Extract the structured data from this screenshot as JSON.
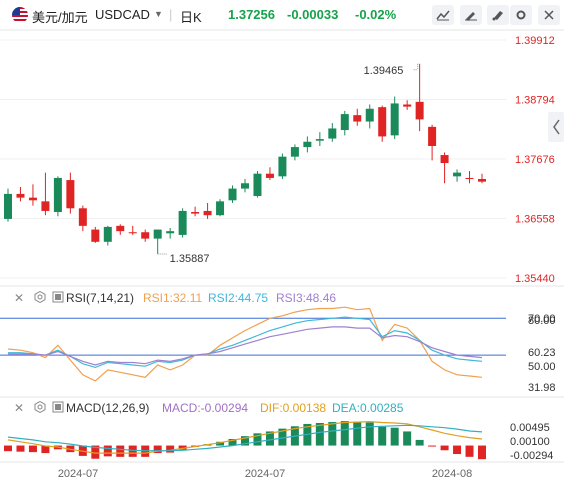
{
  "header": {
    "symbol": "美元/加元",
    "code": "USDCAD",
    "dropdown_icon": "caret-down-icon",
    "timeframe": "日K",
    "price": "1.37256",
    "change": "-0.00033",
    "change_pct": "-0.02%",
    "colors": {
      "up": "#16a34a",
      "down": "#e02424",
      "neutral": "#222222"
    }
  },
  "toolbar_icons": [
    "line-chart-icon",
    "draw-icon",
    "brush-icon",
    "settings-icon",
    "expand-icon",
    "close-icon"
  ],
  "collapse_icon": "chevron-left-icon",
  "rsi_panel": {
    "label": "RSI(7,14,21)",
    "rsi1": "RSI1:32.11",
    "rsi2": "RSI2:44.75",
    "rsi3": "RSI3:48.46",
    "colors": {
      "rsi1": "#f0a050",
      "rsi2": "#40b8d8",
      "rsi3": "#a080d0"
    },
    "axis_labels": [
      "80.00",
      "70.00",
      "60.23",
      "50.00",
      "31.98"
    ]
  },
  "macd_panel": {
    "label": "MACD(12,26,9)",
    "macd": "MACD:-0.00294",
    "dif": "DIF:0.00138",
    "dea": "DEA:0.00285",
    "colors": {
      "macd": "#a070c8",
      "dif": "#e0a020",
      "dea": "#30b0c0"
    },
    "axis_labels": [
      "0.00495",
      "0.00100",
      "-0.00294"
    ]
  },
  "panel_icons": [
    "close-icon",
    "settings-icon",
    "indicator-icon"
  ],
  "chart_data": {
    "type": "candlestick",
    "y_axis_labels": [
      "1.39912",
      "1.38794",
      "1.37676",
      "1.36558",
      "1.35440"
    ],
    "ylim": [
      1.3544,
      1.39912
    ],
    "x_labels": [
      "2024-07",
      "2024-07",
      "2024-08"
    ],
    "annotations": {
      "high": "1.39465",
      "low": "1.35887"
    },
    "colors": {
      "up": "#1a8a5a",
      "down": "#e02424"
    },
    "candles": [
      {
        "o": 1.3655,
        "h": 1.3712,
        "l": 1.365,
        "c": 1.3702
      },
      {
        "o": 1.3702,
        "h": 1.3715,
        "l": 1.3688,
        "c": 1.3695
      },
      {
        "o": 1.3695,
        "h": 1.372,
        "l": 1.368,
        "c": 1.369
      },
      {
        "o": 1.3688,
        "h": 1.3742,
        "l": 1.3662,
        "c": 1.367
      },
      {
        "o": 1.3668,
        "h": 1.3735,
        "l": 1.366,
        "c": 1.3732
      },
      {
        "o": 1.3728,
        "h": 1.3742,
        "l": 1.3665,
        "c": 1.3675
      },
      {
        "o": 1.3675,
        "h": 1.368,
        "l": 1.3632,
        "c": 1.3642
      },
      {
        "o": 1.3635,
        "h": 1.364,
        "l": 1.361,
        "c": 1.3612
      },
      {
        "o": 1.3612,
        "h": 1.3642,
        "l": 1.3605,
        "c": 1.364
      },
      {
        "o": 1.3642,
        "h": 1.3645,
        "l": 1.3625,
        "c": 1.3632
      },
      {
        "o": 1.363,
        "h": 1.3642,
        "l": 1.3625,
        "c": 1.3628
      },
      {
        "o": 1.363,
        "h": 1.3635,
        "l": 1.3612,
        "c": 1.3618
      },
      {
        "o": 1.3618,
        "h": 1.363,
        "l": 1.3589,
        "c": 1.3635
      },
      {
        "o": 1.3628,
        "h": 1.3638,
        "l": 1.3618,
        "c": 1.3632
      },
      {
        "o": 1.3625,
        "h": 1.3675,
        "l": 1.362,
        "c": 1.367
      },
      {
        "o": 1.3668,
        "h": 1.3678,
        "l": 1.366,
        "c": 1.3665
      },
      {
        "o": 1.367,
        "h": 1.3685,
        "l": 1.3655,
        "c": 1.3662
      },
      {
        "o": 1.3662,
        "h": 1.3692,
        "l": 1.366,
        "c": 1.3688
      },
      {
        "o": 1.369,
        "h": 1.3718,
        "l": 1.3685,
        "c": 1.3712
      },
      {
        "o": 1.3712,
        "h": 1.373,
        "l": 1.3705,
        "c": 1.3722
      },
      {
        "o": 1.3698,
        "h": 1.3745,
        "l": 1.3695,
        "c": 1.374
      },
      {
        "o": 1.374,
        "h": 1.3752,
        "l": 1.3728,
        "c": 1.3732
      },
      {
        "o": 1.3735,
        "h": 1.3778,
        "l": 1.373,
        "c": 1.3772
      },
      {
        "o": 1.3772,
        "h": 1.3795,
        "l": 1.3765,
        "c": 1.379
      },
      {
        "o": 1.379,
        "h": 1.381,
        "l": 1.378,
        "c": 1.38
      },
      {
        "o": 1.3802,
        "h": 1.3818,
        "l": 1.3792,
        "c": 1.3805
      },
      {
        "o": 1.3806,
        "h": 1.3835,
        "l": 1.38,
        "c": 1.3825
      },
      {
        "o": 1.3822,
        "h": 1.3858,
        "l": 1.3812,
        "c": 1.3852
      },
      {
        "o": 1.385,
        "h": 1.3862,
        "l": 1.383,
        "c": 1.3838
      },
      {
        "o": 1.3838,
        "h": 1.387,
        "l": 1.3825,
        "c": 1.3862
      },
      {
        "o": 1.3865,
        "h": 1.3868,
        "l": 1.38,
        "c": 1.381
      },
      {
        "o": 1.3812,
        "h": 1.3885,
        "l": 1.3805,
        "c": 1.3872
      },
      {
        "o": 1.387,
        "h": 1.3878,
        "l": 1.386,
        "c": 1.3866
      },
      {
        "o": 1.3875,
        "h": 1.39465,
        "l": 1.382,
        "c": 1.3842
      },
      {
        "o": 1.3828,
        "h": 1.3832,
        "l": 1.3765,
        "c": 1.3792
      },
      {
        "o": 1.3775,
        "h": 1.378,
        "l": 1.3722,
        "c": 1.376
      },
      {
        "o": 1.3735,
        "h": 1.3748,
        "l": 1.3725,
        "c": 1.3742
      },
      {
        "o": 1.3732,
        "h": 1.3745,
        "l": 1.3722,
        "c": 1.373
      },
      {
        "o": 1.373,
        "h": 1.374,
        "l": 1.3722,
        "c": 1.3725
      }
    ],
    "rsi_axis": [
      20,
      90
    ],
    "rsi_levels": [
      80,
      50
    ],
    "rsi1": [
      55,
      54,
      52,
      48,
      58,
      46,
      34,
      29,
      38,
      36,
      34,
      32,
      42,
      38,
      42,
      50,
      50,
      58,
      64,
      70,
      75,
      80,
      82,
      85,
      87,
      88,
      88,
      89,
      87,
      88,
      62,
      75,
      72,
      62,
      45,
      38,
      34,
      33,
      32
    ],
    "rsi2": [
      52,
      52,
      51,
      50,
      54,
      49,
      43,
      40,
      44,
      43,
      42,
      41,
      45,
      44,
      46,
      50,
      51,
      55,
      58,
      62,
      66,
      70,
      73,
      76,
      78,
      79,
      80,
      81,
      80,
      79,
      65,
      70,
      68,
      62,
      54,
      50,
      47,
      46,
      45
    ],
    "rsi3": [
      51,
      51,
      51,
      50,
      53,
      49,
      45,
      42,
      45,
      44,
      44,
      43,
      46,
      45,
      47,
      50,
      51,
      53,
      56,
      59,
      62,
      65,
      67,
      69,
      71,
      72,
      73,
      73,
      72,
      72,
      64,
      66,
      65,
      61,
      56,
      53,
      50,
      49,
      48
    ],
    "macd_axis": [
      -0.0035,
      0.0065
    ],
    "macd_hist": [
      -0.0012,
      -0.0013,
      -0.0014,
      -0.0016,
      -0.0008,
      -0.0014,
      -0.0022,
      -0.0028,
      -0.0023,
      -0.0024,
      -0.0024,
      -0.0024,
      -0.0016,
      -0.0015,
      -0.0009,
      -0.0003,
      0.0003,
      0.0008,
      0.0014,
      0.002,
      0.0026,
      0.003,
      0.0036,
      0.0041,
      0.0046,
      0.0048,
      0.005,
      0.0052,
      0.0051,
      0.0049,
      0.004,
      0.0038,
      0.003,
      0.0012,
      -0.0002,
      -0.001,
      -0.0018,
      -0.0024,
      -0.0029
    ],
    "dif": [
      0.0012,
      0.0008,
      0.0004,
      -0.0001,
      -0.0003,
      -0.0008,
      -0.0012,
      -0.0016,
      -0.0016,
      -0.0016,
      -0.0016,
      -0.0016,
      -0.0012,
      -0.001,
      -0.0006,
      -0.0002,
      0.0002,
      0.0006,
      0.0011,
      0.0016,
      0.0021,
      0.0026,
      0.0031,
      0.0036,
      0.004,
      0.0043,
      0.0046,
      0.0049,
      0.005,
      0.0051,
      0.0049,
      0.0048,
      0.0046,
      0.004,
      0.0033,
      0.0026,
      0.0021,
      0.0017,
      0.0014
    ],
    "dea": [
      0.0018,
      0.0015,
      0.0012,
      0.0008,
      0.0006,
      0.0003,
      -0.0001,
      -0.0004,
      -0.0006,
      -0.0008,
      -0.001,
      -0.0011,
      -0.0011,
      -0.0011,
      -0.001,
      -0.0008,
      -0.0006,
      -0.0003,
      0.0,
      0.0004,
      0.0008,
      0.0012,
      0.0016,
      0.002,
      0.0024,
      0.0028,
      0.0031,
      0.0034,
      0.0037,
      0.004,
      0.0041,
      0.0042,
      0.0043,
      0.0042,
      0.004,
      0.0038,
      0.0035,
      0.0031,
      0.0029
    ]
  }
}
